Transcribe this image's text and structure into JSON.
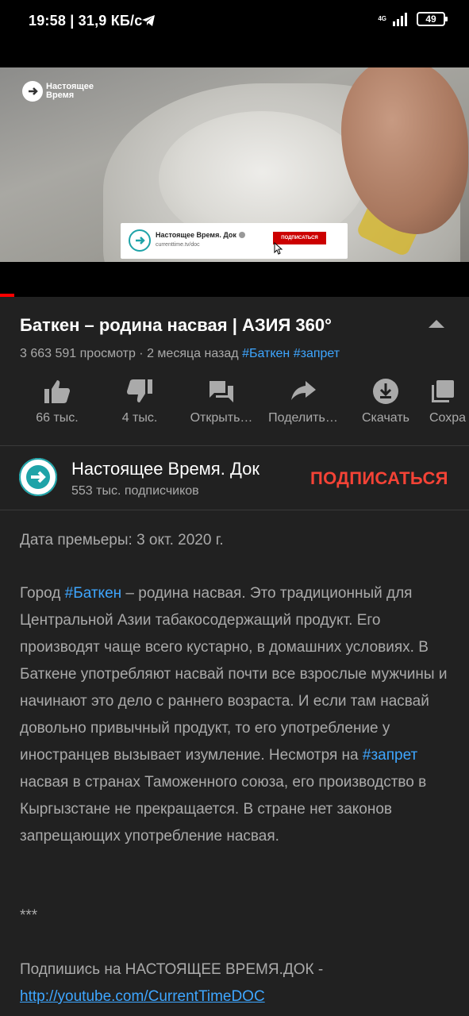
{
  "status_bar": {
    "time_speed": "19:58 | 31,9 КБ/с",
    "network": "4G",
    "battery": "49"
  },
  "video": {
    "logo_text": "Настоящее Время",
    "end_card": {
      "title": "Настоящее Время. Док",
      "url": "currenttime.tv/doc",
      "subscribe": "ПОДПИСАТЬСЯ"
    },
    "progress_fraction": 0.03
  },
  "title": "Баткен – родина насвая | АЗИЯ 360°",
  "meta": {
    "views_date": "3 663 591 просмотр · 2 месяца назад",
    "hashtag1": "#Баткен",
    "hashtag2": "#запрет"
  },
  "actions": [
    {
      "label": "66 тыс.",
      "icon": "thumb-up-icon"
    },
    {
      "label": "4 тыс.",
      "icon": "thumb-down-icon"
    },
    {
      "label": "Открыть…",
      "icon": "comments-icon"
    },
    {
      "label": "Поделить…",
      "icon": "share-icon"
    },
    {
      "label": "Скачать",
      "icon": "download-icon"
    },
    {
      "label": "Сохра",
      "icon": "save-playlist-icon"
    }
  ],
  "channel": {
    "name": "Настоящее Время. Док",
    "subscribers": "553 тыс. подписчиков",
    "subscribe_label": "ПОДПИСАТЬСЯ"
  },
  "description": {
    "premiere": "Дата премьеры: 3 окт. 2020 г.",
    "p1_before": "Город ",
    "p1_tag1": "#Баткен",
    "p1_mid": " – родина насвая. Это традиционный для Центральной Азии табакосодержащий продукт. Его производят чаще всего кустарно, в домашних условиях. В Баткене употребляют насвай почти все взрослые мужчины и начинают это дело с раннего возраста. И если там насвай довольно привычный продукт, то его употребление у иностранцев вызывает изумление. Несмотря на ",
    "p1_tag2": "#запрет",
    "p1_after": " насвая в странах Таможенного союза, его производство в Кыргызстане не прекращается. В стране нет законов запрещающих употребление насвая.",
    "separator": "***",
    "subscribe_text": "Подпишись на НАСТОЯЩЕЕ ВРЕМЯ.ДОК -",
    "link": "http://youtube.com/CurrentTimeDOC"
  },
  "colors": {
    "accent_red": "#f44336",
    "link_blue": "#3ea6ff",
    "background": "#212121"
  }
}
